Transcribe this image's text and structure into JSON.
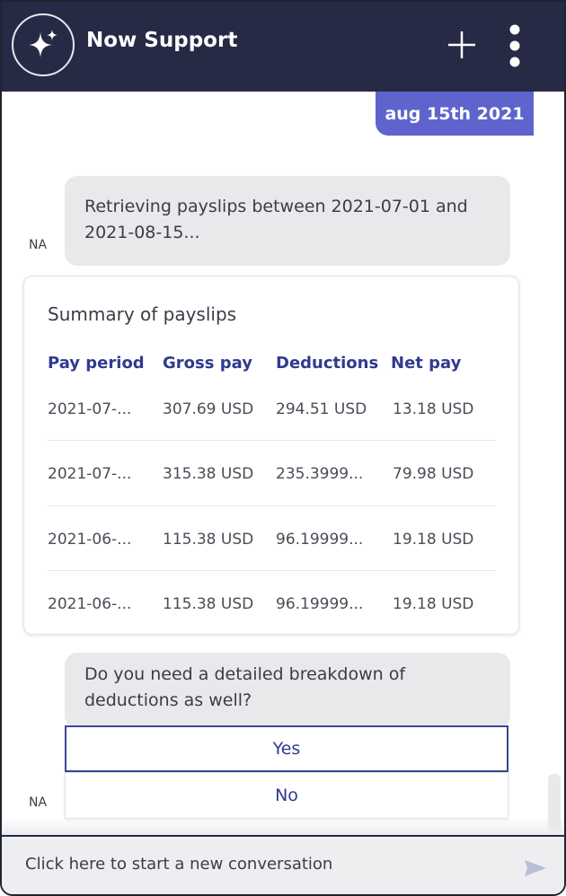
{
  "header": {
    "title": "Now Support"
  },
  "messages": {
    "user_date": "aug 15th 2021",
    "bot_retrieving": "Retrieving payslips between 2021-07-01 and 2021-08-15...",
    "avatar_initials": "NA",
    "bot_question": "Do you need a detailed breakdown of deductions as well?"
  },
  "summary": {
    "title": "Summary of payslips",
    "columns": [
      "Pay period",
      "Gross pay",
      "Deductions",
      "Net pay"
    ],
    "rows": [
      [
        "2021-07-...",
        "307.69 USD",
        "294.51 USD",
        "13.18 USD"
      ],
      [
        "2021-07-...",
        "315.38 USD",
        "235.3999...",
        "79.98 USD"
      ],
      [
        "2021-06-...",
        "115.38 USD",
        "96.19999...",
        "19.18 USD"
      ],
      [
        "2021-06-...",
        "115.38 USD",
        "96.19999...",
        "19.18 USD"
      ]
    ]
  },
  "options": {
    "yes": "Yes",
    "no": "No"
  },
  "composer": {
    "placeholder": "Click here to start a new conversation"
  },
  "icons": {
    "logo": "sparkle-icon",
    "new": "plus-icon",
    "menu": "more-vertical-icon",
    "send": "send-icon"
  },
  "colors": {
    "header": "#262a45",
    "user_bubble": "#5e64cc",
    "link": "#2f3a8f"
  }
}
